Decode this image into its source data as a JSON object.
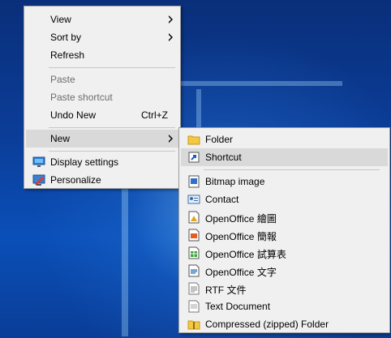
{
  "context_menu": {
    "items": {
      "view": "View",
      "sort_by": "Sort by",
      "refresh": "Refresh",
      "paste": "Paste",
      "paste_shortcut": "Paste shortcut",
      "undo_new": "Undo New",
      "undo_new_accel": "Ctrl+Z",
      "new": "New",
      "display_settings": "Display settings",
      "personalize": "Personalize"
    }
  },
  "new_submenu": {
    "items": {
      "folder": "Folder",
      "shortcut": "Shortcut",
      "bitmap": "Bitmap image",
      "contact": "Contact",
      "oo_draw": "OpenOffice 繪圖",
      "oo_impress": "OpenOffice 簡報",
      "oo_calc": "OpenOffice 試算表",
      "oo_writer": "OpenOffice 文字",
      "rtf": "RTF 文件",
      "text": "Text Document",
      "zip": "Compressed (zipped) Folder"
    }
  },
  "colors": {
    "menu_bg": "#f0f0f0",
    "highlight": "#d9d9d9",
    "disabled_text": "#6d6d6d",
    "desktop_blue": "#0b3d98"
  },
  "icons": [
    "folder-icon",
    "shortcut-icon",
    "bitmap-icon",
    "contact-icon",
    "openoffice-draw-icon",
    "openoffice-impress-icon",
    "openoffice-calc-icon",
    "openoffice-writer-icon",
    "rtf-icon",
    "text-document-icon",
    "zip-folder-icon",
    "display-icon",
    "personalize-icon"
  ]
}
